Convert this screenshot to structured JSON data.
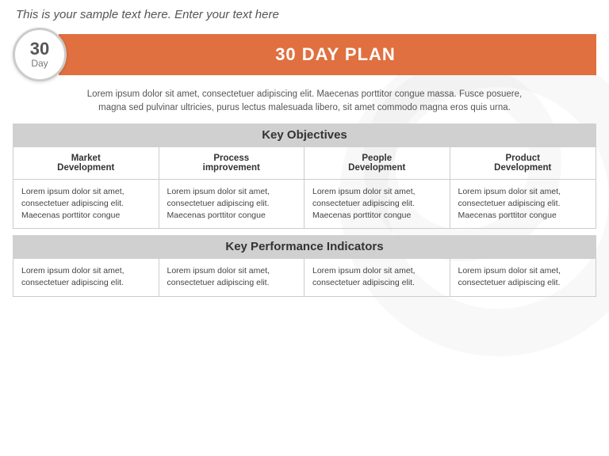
{
  "page": {
    "sample_text": "This is your sample text here. Enter your text here",
    "day_badge": {
      "number": "30",
      "label": "Day"
    },
    "banner": {
      "title": "30 DAY PLAN"
    },
    "description": "Lorem ipsum dolor sit amet, consectetuer adipiscing elit.  Maecenas porttitor congue massa. Fusce posuere, magna sed pulvinar ultricies, purus lectus malesuada libero, sit amet commodo magna eros quis urna.",
    "key_objectives": {
      "header": "Key Objectives",
      "columns": [
        {
          "title": "Market\nDevelopment"
        },
        {
          "title": "Process\nimprovement"
        },
        {
          "title": "People\nDevelopment"
        },
        {
          "title": "Product\nDevelopment"
        }
      ],
      "content": [
        "Lorem ipsum dolor sit amet, consectetuer adipiscing elit. Maecenas porttitor congue",
        "Lorem ipsum dolor sit amet, consectetuer adipiscing elit. Maecenas porttitor congue",
        "Lorem ipsum dolor sit amet, consectetuer adipiscing elit. Maecenas porttitor congue",
        "Lorem ipsum dolor sit amet, consectetuer adipiscing elit. Maecenas porttitor congue"
      ]
    },
    "key_performance": {
      "header": "Key Performance Indicators",
      "content": [
        "Lorem ipsum dolor sit amet, consectetuer adipiscing elit.",
        "Lorem ipsum dolor sit amet, consectetuer adipiscing elit.",
        "Lorem ipsum dolor sit amet, consectetuer adipiscing elit.",
        "Lorem ipsum dolor sit amet, consectetuer adipiscing elit."
      ]
    }
  }
}
